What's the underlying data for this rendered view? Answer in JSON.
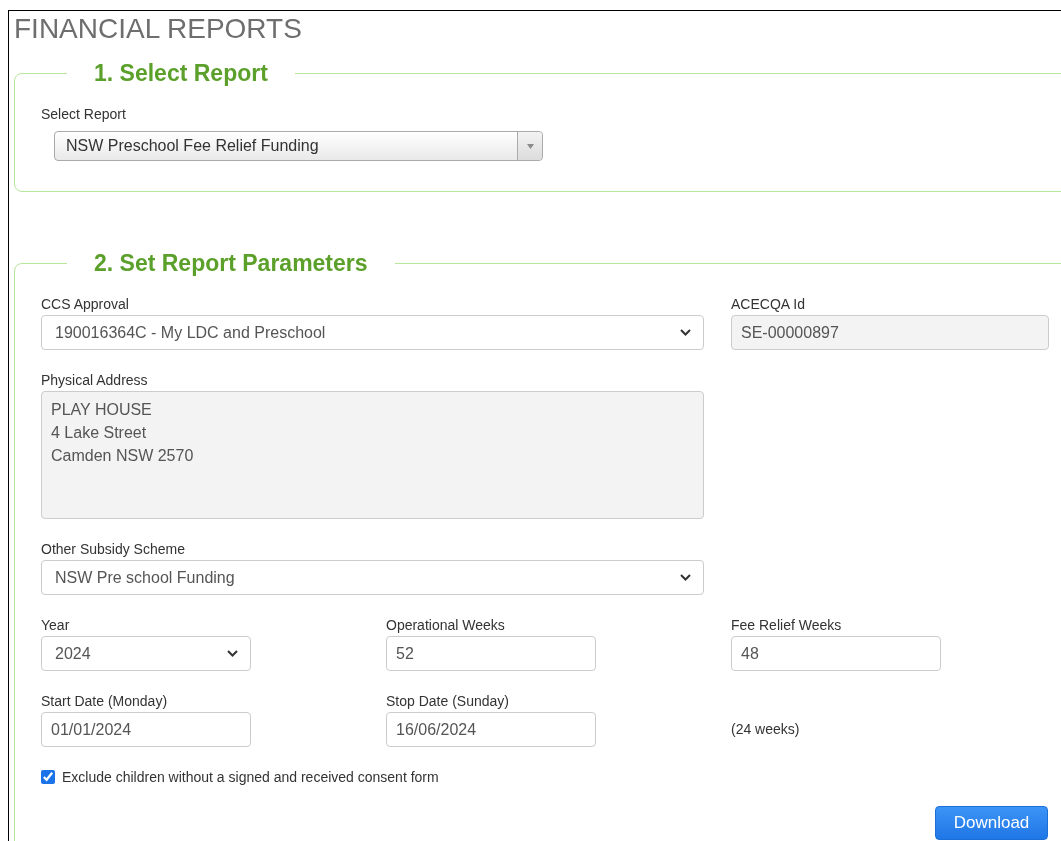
{
  "page_title": "FINANCIAL REPORTS",
  "select_report": {
    "legend": "1. Select Report",
    "label": "Select Report",
    "value": "NSW Preschool Fee Relief Funding"
  },
  "parameters": {
    "legend": "2. Set Report Parameters",
    "rows": [
      [
        {
          "kind": "select",
          "label": "CCS Approval",
          "value": "190016364C - My LDC and Preschool"
        },
        "",
        {
          "kind": "input",
          "label": "ACECQA Id",
          "value": "SE-00000897",
          "disabled": true
        }
      ],
      [
        {
          "kind": "textarea",
          "label": "Physical Address",
          "lines": [
            "PLAY HOUSE",
            "4 Lake Street",
            "Camden NSW 2570"
          ],
          "disabled": true
        },
        ""
      ],
      [
        {
          "kind": "select",
          "label": "Other Subsidy Scheme",
          "value": "NSW Pre school Funding"
        },
        ""
      ],
      [
        {
          "kind": "select",
          "label": "Year",
          "value": "2024"
        },
        {
          "kind": "input",
          "label": "Operational Weeks",
          "value": "52",
          "disabled": false
        },
        {
          "kind": "input",
          "label": "Fee Relief Weeks",
          "value": "48",
          "disabled": false
        }
      ],
      [
        {
          "kind": "input",
          "label": "Start Date (Monday)",
          "value": "01/01/2024",
          "disabled": false
        },
        {
          "kind": "input",
          "label": "Stop Date (Sunday)",
          "value": "16/06/2024",
          "disabled": false
        },
        {
          "kind": "note",
          "text": "(24 weeks)"
        }
      ]
    ],
    "checkbox": {
      "label": "Exclude children without a signed and received consent form",
      "checked": true
    },
    "download_button": "Download"
  }
}
